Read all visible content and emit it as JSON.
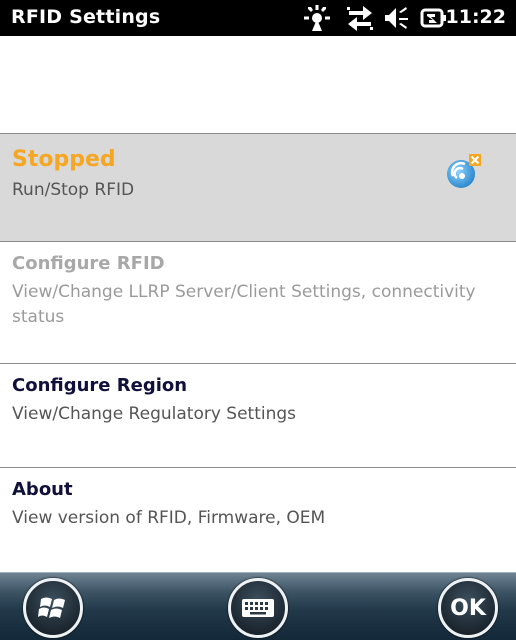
{
  "status_bar": {
    "title": "RFID Settings",
    "time": "11:22",
    "icons": [
      "signal-icon",
      "sync-arrows-icon",
      "speaker-icon",
      "battery-icon"
    ]
  },
  "menu": {
    "items": [
      {
        "title": "Stopped",
        "description": "Run/Stop RFID",
        "icon": "rfid-stopped-icon",
        "selected": true
      },
      {
        "title": "Configure RFID",
        "description": "View/Change LLRP Server/Client Settings, connectivity status",
        "enabled": false
      },
      {
        "title": "Configure Region",
        "description": "View/Change Regulatory Settings",
        "enabled": true
      },
      {
        "title": "About",
        "description": "View version of RFID, Firmware, OEM",
        "enabled": true
      }
    ]
  },
  "softkeys": {
    "left_icon": "windows-start-icon",
    "center_icon": "keyboard-icon",
    "right_label": "OK"
  },
  "colors": {
    "status_text": "#f5a623",
    "selected_bg": "#d9d9d9",
    "disabled_text": "#a8a8a8",
    "title_text": "#10103a"
  }
}
